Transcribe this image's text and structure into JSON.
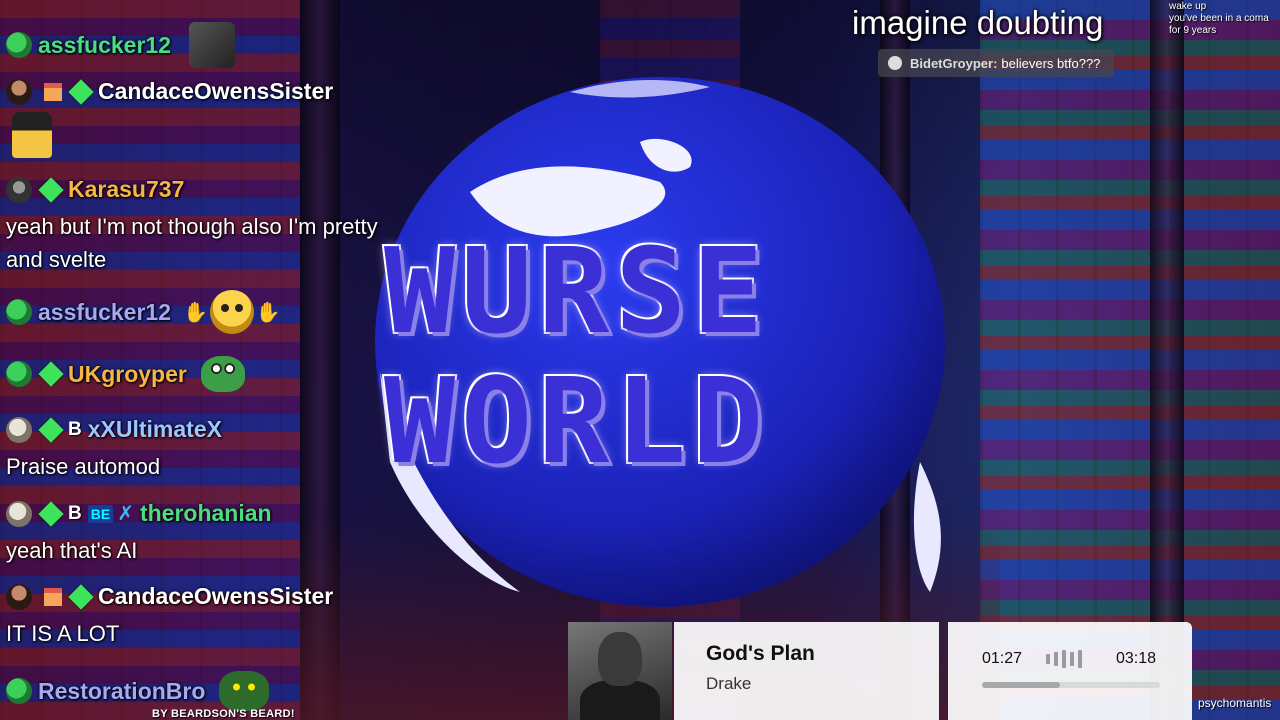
{
  "chat": {
    "messages": [
      {
        "user": "assfucker12",
        "color": "#4ade80"
      },
      {
        "user": "CandaceOwensSister",
        "color": "#ffffff"
      },
      {
        "user": "Karasu737",
        "color": "#f5b742",
        "text": "yeah but I'm not though also I'm pretty and svelte"
      },
      {
        "user": "assfucker12",
        "color": "#a8a8f0"
      },
      {
        "user": "UKgroyper",
        "color": "#f5b742"
      },
      {
        "user": "xXUltimateX",
        "color": "#9ec5ff",
        "badge": "B",
        "text": "Praise automod"
      },
      {
        "user": "therohanian",
        "color": "#4ade80",
        "badge": "B",
        "tag": "BE",
        "text": "yeah that's AI"
      },
      {
        "user": "CandaceOwensSister",
        "color": "#ffffff",
        "text": "IT IS A LOT"
      },
      {
        "user": "RestorationBro",
        "color": "#a8a8f0"
      }
    ],
    "footer_note": "BY BEARDSON'S BEARD!"
  },
  "logo": {
    "line1": "WURSE",
    "line2": "WORLD"
  },
  "alert": {
    "headline": "imagine doubting",
    "notice_lines": [
      "wake up",
      "you've been in a coma",
      "for 9 years"
    ],
    "mini_chat": {
      "user": "BidetGroyper:",
      "text": "believers btfo???"
    }
  },
  "now_playing": {
    "title": "God's Plan",
    "artist": "Drake",
    "current_time": "01:27",
    "duration": "03:18",
    "progress": 0.44
  },
  "watermark": "psychomantis",
  "colors": {
    "accent_green": "#3de35a",
    "globe_blue": "#1f2fd0"
  }
}
